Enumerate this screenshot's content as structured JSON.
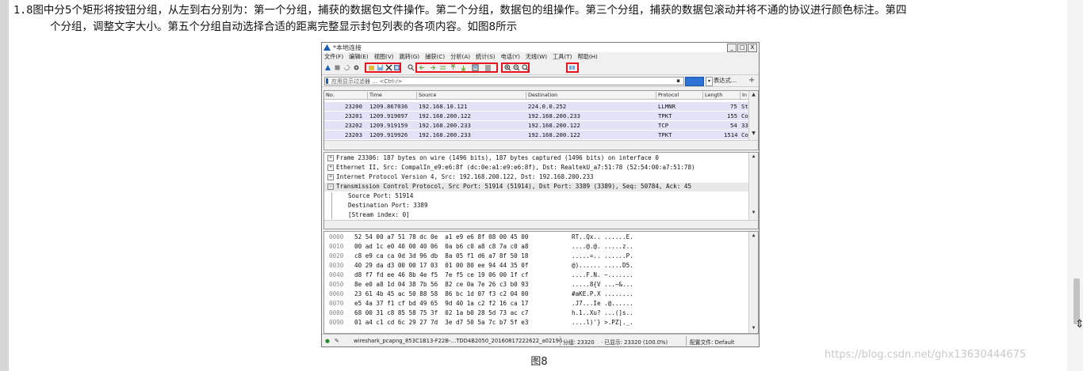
{
  "paragraph": {
    "number": "1.8",
    "line1": "图中分5个矩形将按钮分组，从左到右分别为：第一个分组，捕获的数据包文件操作。第二个分组，数据包的组操作。第三个分组，捕获的数据包滚动并将不通的协议进行颜色标注。第四",
    "line2": "个分组，调整文字大小。第五个分组自动选择合适的距离完整显示封包列表的各项内容。如图8所示"
  },
  "window": {
    "title": "*本地连接",
    "buttons": [
      "_",
      "□",
      "X"
    ],
    "menu": [
      "文件(F)",
      "编辑(E)",
      "视图(V)",
      "跳转(G)",
      "捕获(C)",
      "分析(A)",
      "统计(S)",
      "电话(Y)",
      "无线(W)",
      "工具(T)",
      "帮助(H)"
    ]
  },
  "filter": {
    "placeholder": "应用显示过滤器 … <Ctrl-/>",
    "expression_label": "表达式…",
    "plus": "+"
  },
  "packet_list": {
    "columns": [
      "No.",
      "Time",
      "Source",
      "Destination",
      "Protocol",
      "Length",
      "In"
    ],
    "rows": [
      {
        "no": "23200",
        "time": "1209.867036",
        "src": "192.168.10.121",
        "dst": "224.0.0.252",
        "proto": "LLMNR",
        "len": "75",
        "info": "St"
      },
      {
        "no": "23201",
        "time": "1209.919097",
        "src": "192.168.200.122",
        "dst": "192.168.200.233",
        "proto": "TPKT",
        "len": "155",
        "info": "Co"
      },
      {
        "no": "23202",
        "time": "1209.919159",
        "src": "192.168.200.233",
        "dst": "192.168.200.122",
        "proto": "TCP",
        "len": "54",
        "info": "33"
      },
      {
        "no": "23203",
        "time": "1209.919926",
        "src": "192.168.200.233",
        "dst": "192.168.200.122",
        "proto": "TPKT",
        "len": "1514",
        "info": "Co"
      }
    ]
  },
  "packet_details": [
    {
      "exp": "+",
      "text": "Frame 23306: 187 bytes on wire (1496 bits), 187 bytes captured (1496 bits) on interface 0"
    },
    {
      "exp": "+",
      "text": "Ethernet II, Src: CompalIn_e9:e6:8f (dc:0e:a1:e9:e6:8f), Dst: RealtekU_a7:51:78 (52:54:00:a7:51:78)"
    },
    {
      "exp": "+",
      "text": "Internet Protocol Version 4, Src: 192.168.200.122, Dst: 192.168.200.233"
    },
    {
      "exp": "-",
      "text": "Transmission Control Protocol, Src Port: 51914 (51914), Dst Port: 3389 (3389), Seq: 50784, Ack: 45"
    },
    {
      "exp": "",
      "text": "Source Port: 51914"
    },
    {
      "exp": "",
      "text": "Destination Port: 3389"
    },
    {
      "exp": "",
      "text": "[Stream index: 0]"
    }
  ],
  "packet_bytes": [
    {
      "off": "0000",
      "hex": "52 54 00 a7 51 78 dc 0e  a1 e9 e6 8f 08 00 45 00",
      "ascii": "RT..Qx.. ......E."
    },
    {
      "off": "0010",
      "hex": "00 ad 1c e0 40 00 40 06  0a b6 c0 a8 c8 7a c0 a8",
      "ascii": "....@.@. .....z.."
    },
    {
      "off": "0020",
      "hex": "c8 e9 ca ca 0d 3d 96 db  8a 05 f1 d6 a7 8f 50 18",
      "ascii": ".....=.. ......P."
    },
    {
      "off": "0030",
      "hex": "40 29 da d3 00 00 17 03  01 00 80 ee 94 44 35 0f",
      "ascii": "@)...... .....D5."
    },
    {
      "off": "0040",
      "hex": "d8 f7 fd ee 46 8b 4e f5  7e f5 ce 19 06 00 1f cf",
      "ascii": "....F.N. ~......."
    },
    {
      "off": "0050",
      "hex": "8e e0 a8 1d 04 38 7b 56  82 ce 0a 7e 26 c3 b0 93",
      "ascii": ".....8{V ...~&..."
    },
    {
      "off": "0060",
      "hex": "23 61 4b 45 ac 50 88 58  86 bc 1d 07 f3 c2 04 00",
      "ascii": "#aKE.P.X ........"
    },
    {
      "off": "0070",
      "hex": "e5 4a 37 f1 cf bd 49 65  9d 40 1a c2 f2 16 ca 17",
      "ascii": ".J7...Ie .@......"
    },
    {
      "off": "0080",
      "hex": "68 00 31 c8 85 58 75 3f  02 1a b0 28 5d 73 ac c7",
      "ascii": "h.1..Xu? ...(]s.."
    },
    {
      "off": "0090",
      "hex": "01 a4 c1 cd 6c 29 27 7d  3e d7 50 5a 7c b7 5f e3",
      "ascii": "....l)'} >.PZ|._."
    }
  ],
  "status": {
    "file": "wireshark_pcapng_853C1B13-F22B-…TDD4B2050_20160817222622_a02196",
    "packets": "分组: 23320",
    "displayed": "· 已显示: 23320 (100.0%)",
    "profile": "配置文件: Default"
  },
  "caption": "图8",
  "watermark": "https://blog.csdn.net/ghx13630444675",
  "colors": {
    "highlight": "#e8141d",
    "row_bg": "#e3e3f8",
    "accent": "#2d73d5"
  }
}
